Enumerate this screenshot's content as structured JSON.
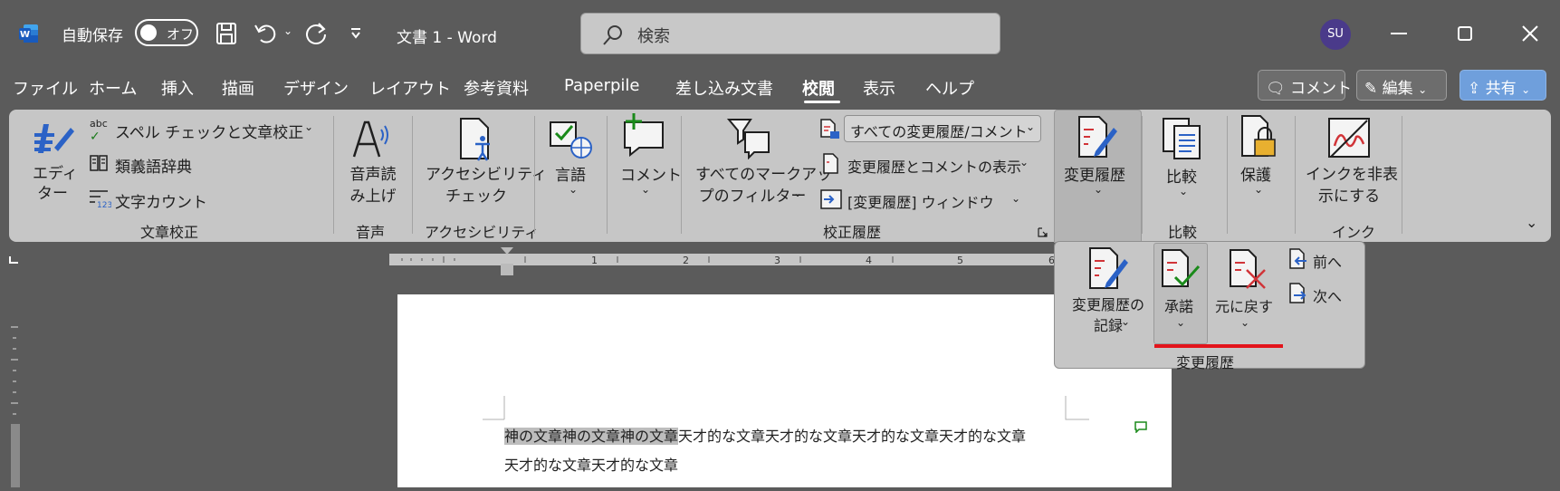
{
  "titlebar": {
    "autosave_label": "自動保存",
    "autosave_state": "オフ",
    "doc_title": "文書 1  -  Word",
    "search_placeholder": "検索",
    "avatar_initials": "SU"
  },
  "tabs": [
    "ファイル",
    "ホーム",
    "挿入",
    "描画",
    "デザイン",
    "レイアウト",
    "参考資料",
    "Paperpile",
    "差し込み文書",
    "校閲",
    "表示",
    "ヘルプ"
  ],
  "active_tab": "校閲",
  "header_buttons": {
    "comment": "コメント",
    "edit": "編集",
    "share": "共有"
  },
  "ribbon": {
    "editor": "エディ\nター",
    "spell": "スペル チェックと文章校正",
    "thesaurus": "類義語辞典",
    "wordcount": "文字カウント",
    "group_proofing": "文章校正",
    "read_aloud": "音声読\nみ上げ",
    "group_speech": "音声",
    "accessibility": "アクセシビリティ\nチェック",
    "group_accessibility": "アクセシビリティ",
    "language": "言語",
    "comment": "コメント",
    "markup_filter": "すべてのマークアッ\nプのフィルター",
    "markup_select": "すべての変更履歴/コメント",
    "show_markup": "変更履歴とコメントの表示",
    "review_pane": "[変更履歴] ウィンドウ",
    "group_tracking": "校正履歴",
    "track_changes": "変更履歴",
    "compare": "比較",
    "group_compare": "比較",
    "protect": "保護",
    "hide_ink": "インクを非表\n示にする",
    "group_ink": "インク"
  },
  "dropdown": {
    "record": "変更履歴の\n記録",
    "accept": "承諾",
    "reject": "元に戻す",
    "previous": "前へ",
    "next": "次へ",
    "group": "変更履歴"
  },
  "ruler_numbers": [
    "1",
    "2",
    "3",
    "4",
    "5",
    "6"
  ],
  "document": {
    "line1_highlight": "神の文章神の文章神の文章",
    "line1_rest": "天才的な文章天才的な文章天才的な文章天才的な文章",
    "line2": "天才的な文章天才的な文章"
  }
}
